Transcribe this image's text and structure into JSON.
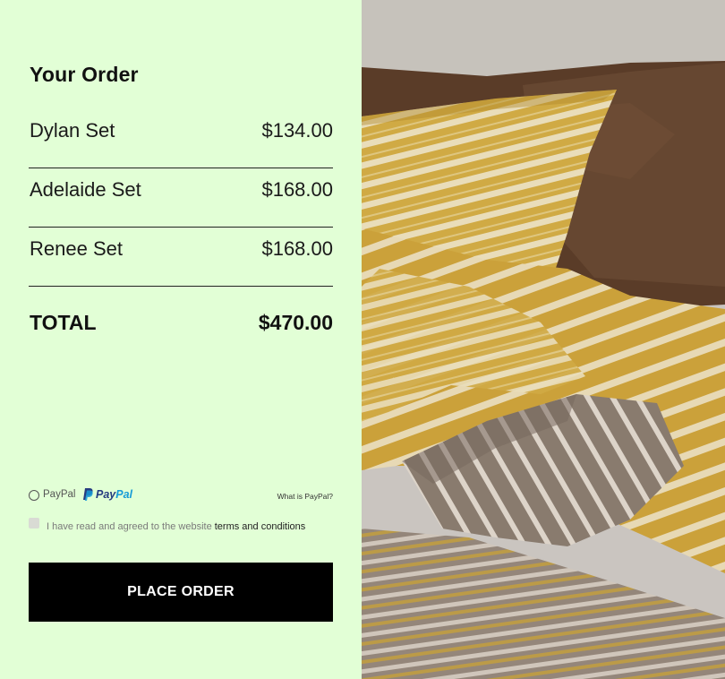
{
  "order": {
    "title": "Your Order",
    "items": [
      {
        "name": "Dylan Set",
        "price": "$134.00"
      },
      {
        "name": "Adelaide Set",
        "price": "$168.00"
      },
      {
        "name": "Renee Set",
        "price": "$168.00"
      }
    ],
    "total_label": "TOTAL",
    "total_value": "$470.00"
  },
  "payment": {
    "option_label": "PayPal",
    "logo_text_pay": "Pay",
    "logo_text_pal": "Pal",
    "what_link": "What is PayPal?",
    "terms_text": "I have read and agreed to the website ",
    "terms_link": "terms and conditions",
    "checkbox_checked": false,
    "radio_selected": false
  },
  "button": {
    "label": "PLACE ORDER"
  },
  "colors": {
    "panel_bg": "#e2ffd6",
    "button_bg": "#000000",
    "paypal_dark": "#253b80",
    "paypal_light": "#179bd7"
  },
  "icons": [
    "paypal-logo-icon"
  ],
  "image": {
    "subject": "striped-bedding-photo"
  }
}
